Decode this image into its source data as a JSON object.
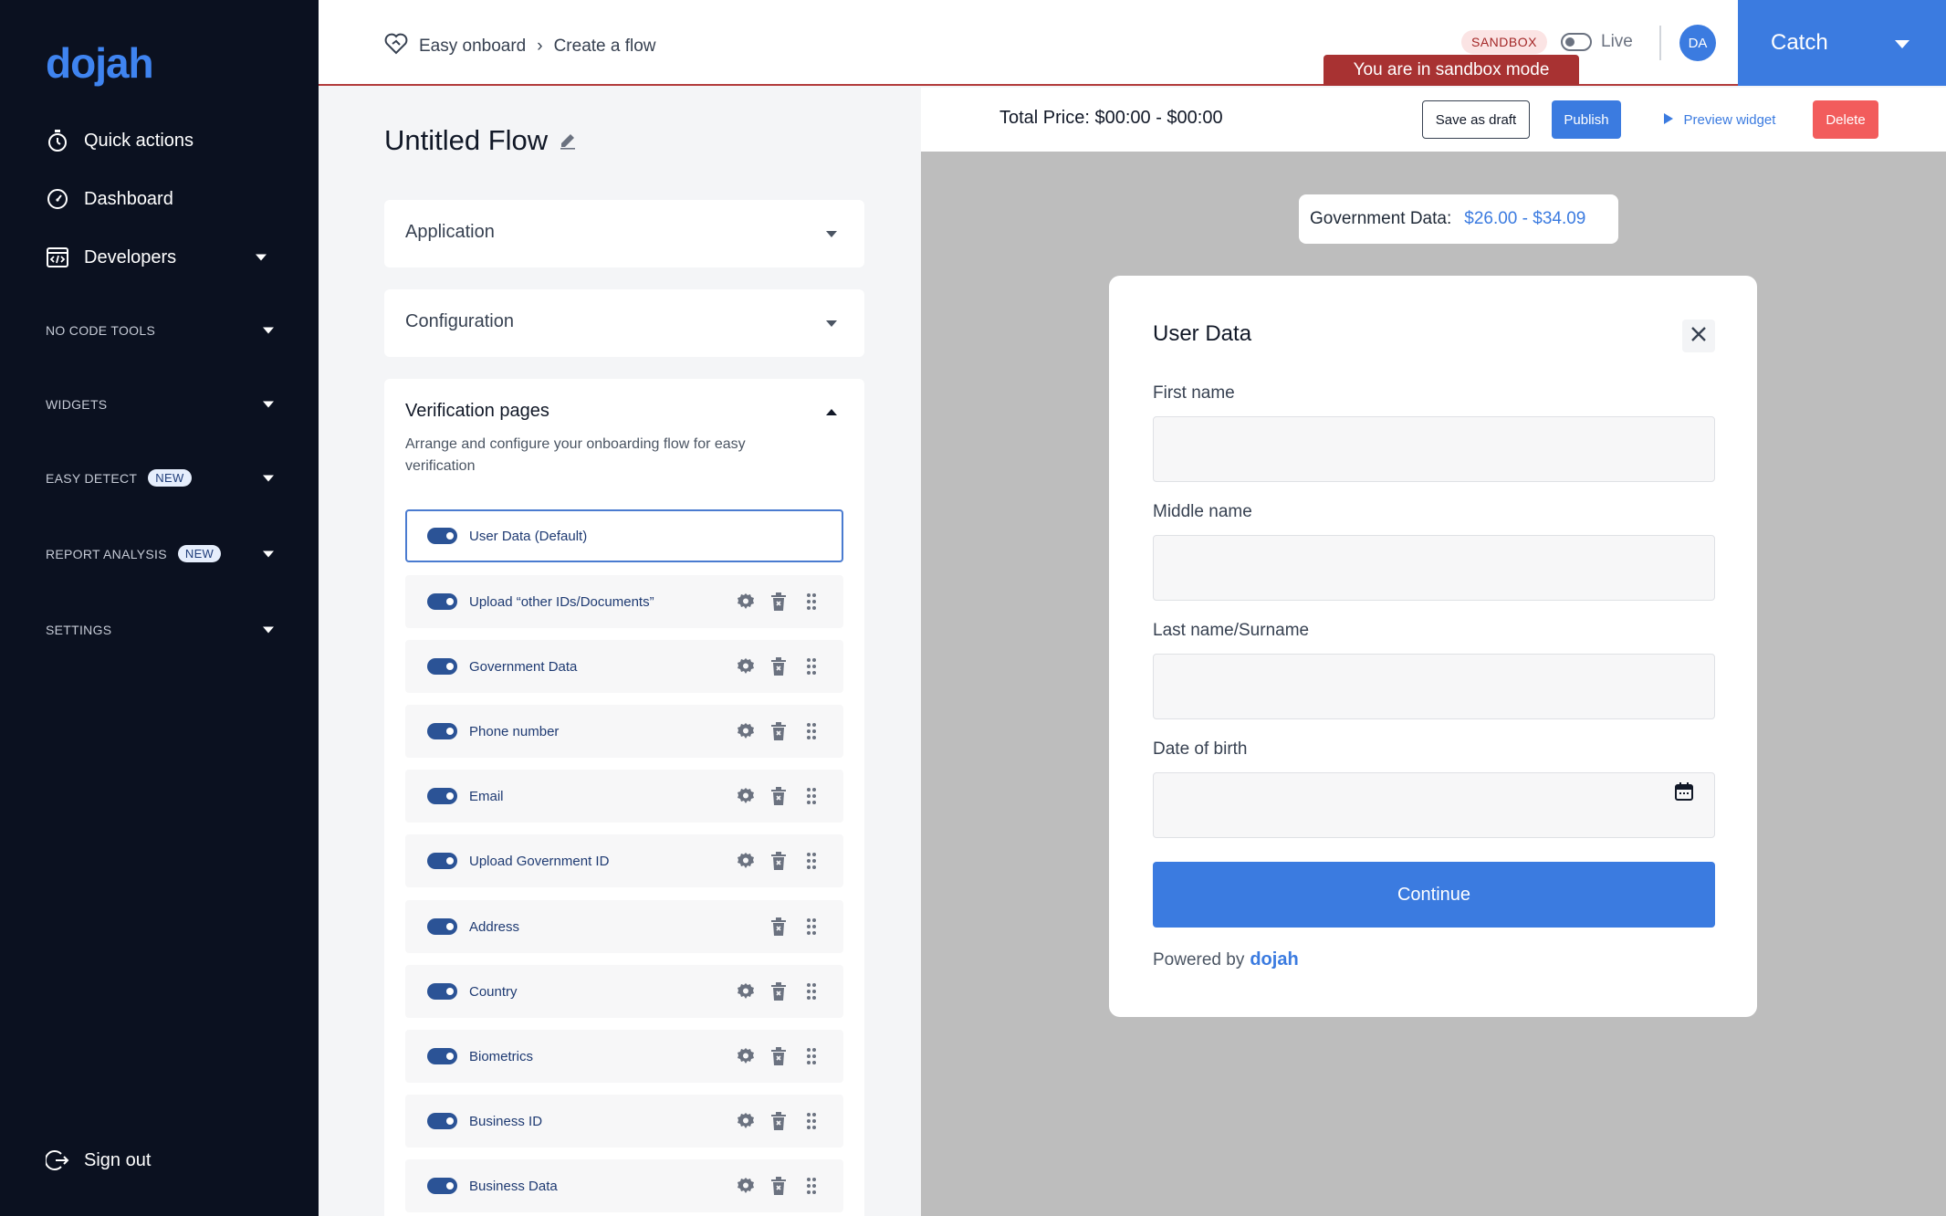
{
  "sidebar": {
    "logo": "dojah",
    "nav": [
      {
        "label": "Quick actions",
        "icon": "stopwatch-icon"
      },
      {
        "label": "Dashboard",
        "icon": "gauge-icon"
      },
      {
        "label": "Developers",
        "icon": "code-icon"
      }
    ],
    "sections": [
      {
        "label": "NO CODE TOOLS"
      },
      {
        "label": "WIDGETS"
      },
      {
        "label": "EASY DETECT",
        "badge": "NEW"
      },
      {
        "label": "REPORT ANALYSIS",
        "badge": "NEW"
      },
      {
        "label": "SETTINGS"
      }
    ],
    "sign_out": "Sign out"
  },
  "header": {
    "breadcrumb": [
      "Easy onboard",
      "Create a flow"
    ],
    "sandbox_pill": "SANDBOX",
    "live_label": "Live",
    "avatar_initials": "DA",
    "account_name": "Catch",
    "sandbox_banner": "You are in sandbox mode"
  },
  "builder": {
    "flow_title": "Untitled Flow",
    "accordions": {
      "application": "Application",
      "configuration": "Configuration",
      "verification_title": "Verification pages",
      "verification_desc": "Arrange and configure your onboarding flow for easy verification"
    },
    "pages": [
      {
        "label": "User Data (Default)",
        "default": true
      },
      {
        "label": "Upload “other IDs/Documents”"
      },
      {
        "label": "Government Data"
      },
      {
        "label": "Phone number"
      },
      {
        "label": "Email"
      },
      {
        "label": "Upload Government ID"
      },
      {
        "label": "Address"
      },
      {
        "label": "Country"
      },
      {
        "label": "Biometrics"
      },
      {
        "label": "Business ID"
      },
      {
        "label": "Business Data"
      }
    ]
  },
  "toolbar": {
    "total_price": "Total Price: $00:00 - $00:00",
    "save_draft": "Save as draft",
    "publish": "Publish",
    "preview": "Preview widget",
    "delete": "Delete"
  },
  "preview": {
    "gov_label": "Government Data:",
    "gov_price": "$26.00 - $34.09",
    "modal_title": "User Data",
    "fields": [
      {
        "label": "First name",
        "value": ""
      },
      {
        "label": "Middle name",
        "value": ""
      },
      {
        "label": "Last name/Surname",
        "value": ""
      },
      {
        "label": "Date of birth",
        "value": ""
      }
    ],
    "continue": "Continue",
    "powered_by": "Powered by",
    "powered_brand": "dojah"
  },
  "colors": {
    "sidebar_bg": "#0b1120",
    "accent": "#3b7be0",
    "sandbox_red": "#a83232",
    "delete_red": "#f25c5c"
  }
}
